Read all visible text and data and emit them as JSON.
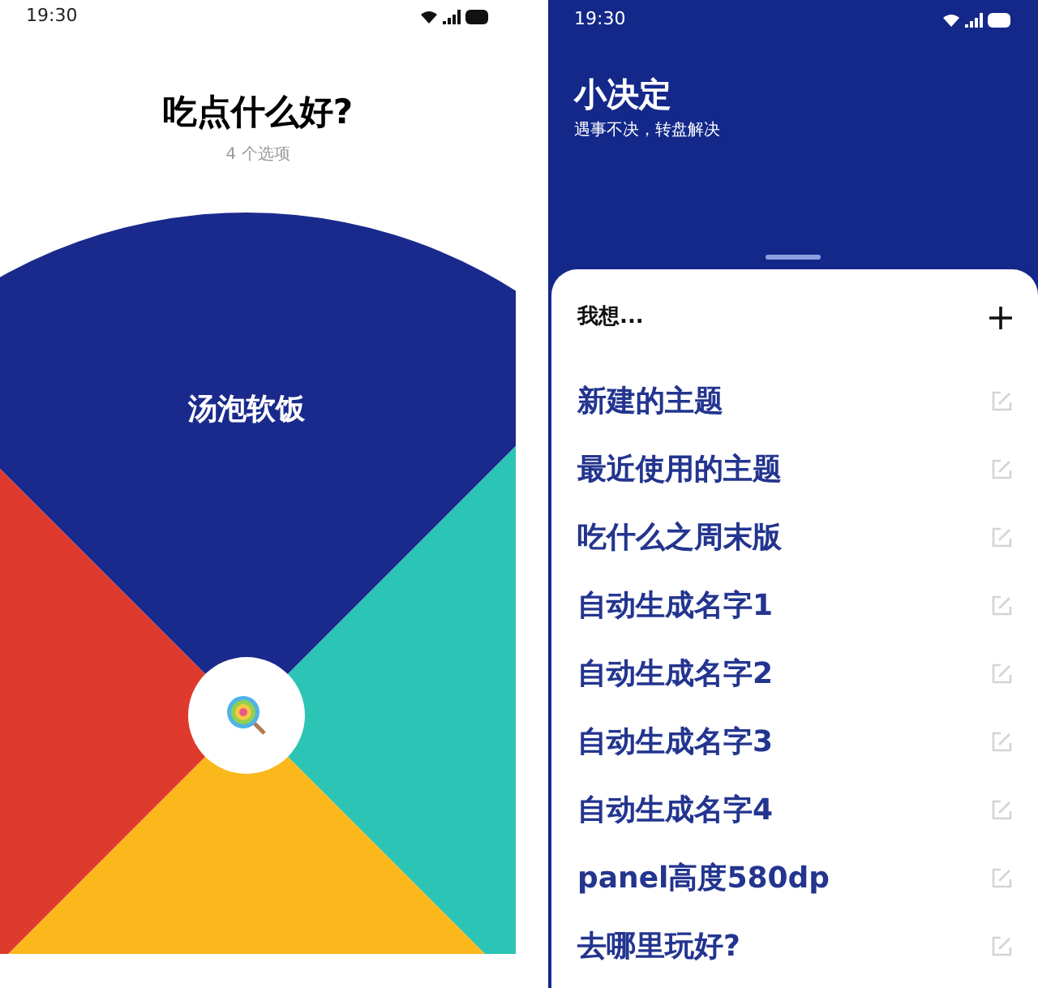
{
  "wheel_screen": {
    "status_bar": {
      "time": "19:30"
    },
    "title": "吃点什么好?",
    "subtitle": "4 个选项",
    "wheel": {
      "segments": [
        {
          "color": "#1a2a8c",
          "label": "汤泡软饭"
        },
        {
          "color": "#2cc4b4"
        },
        {
          "color": "#fbb81c"
        },
        {
          "color": "#df3a2e"
        }
      ]
    }
  },
  "list_screen": {
    "status_bar": {
      "time": "19:30"
    },
    "title": "小决定",
    "subtitle": "遇事不决，转盘解决",
    "sheet": {
      "heading": "我想...",
      "items": [
        {
          "label": "新建的主题"
        },
        {
          "label": "最近使用的主题"
        },
        {
          "label": "吃什么之周末版"
        },
        {
          "label": "自动生成名字1"
        },
        {
          "label": "自动生成名字2"
        },
        {
          "label": "自动生成名字3"
        },
        {
          "label": "自动生成名字4"
        },
        {
          "label": "panel高度580dp"
        },
        {
          "label": "去哪里玩好?"
        }
      ]
    }
  }
}
